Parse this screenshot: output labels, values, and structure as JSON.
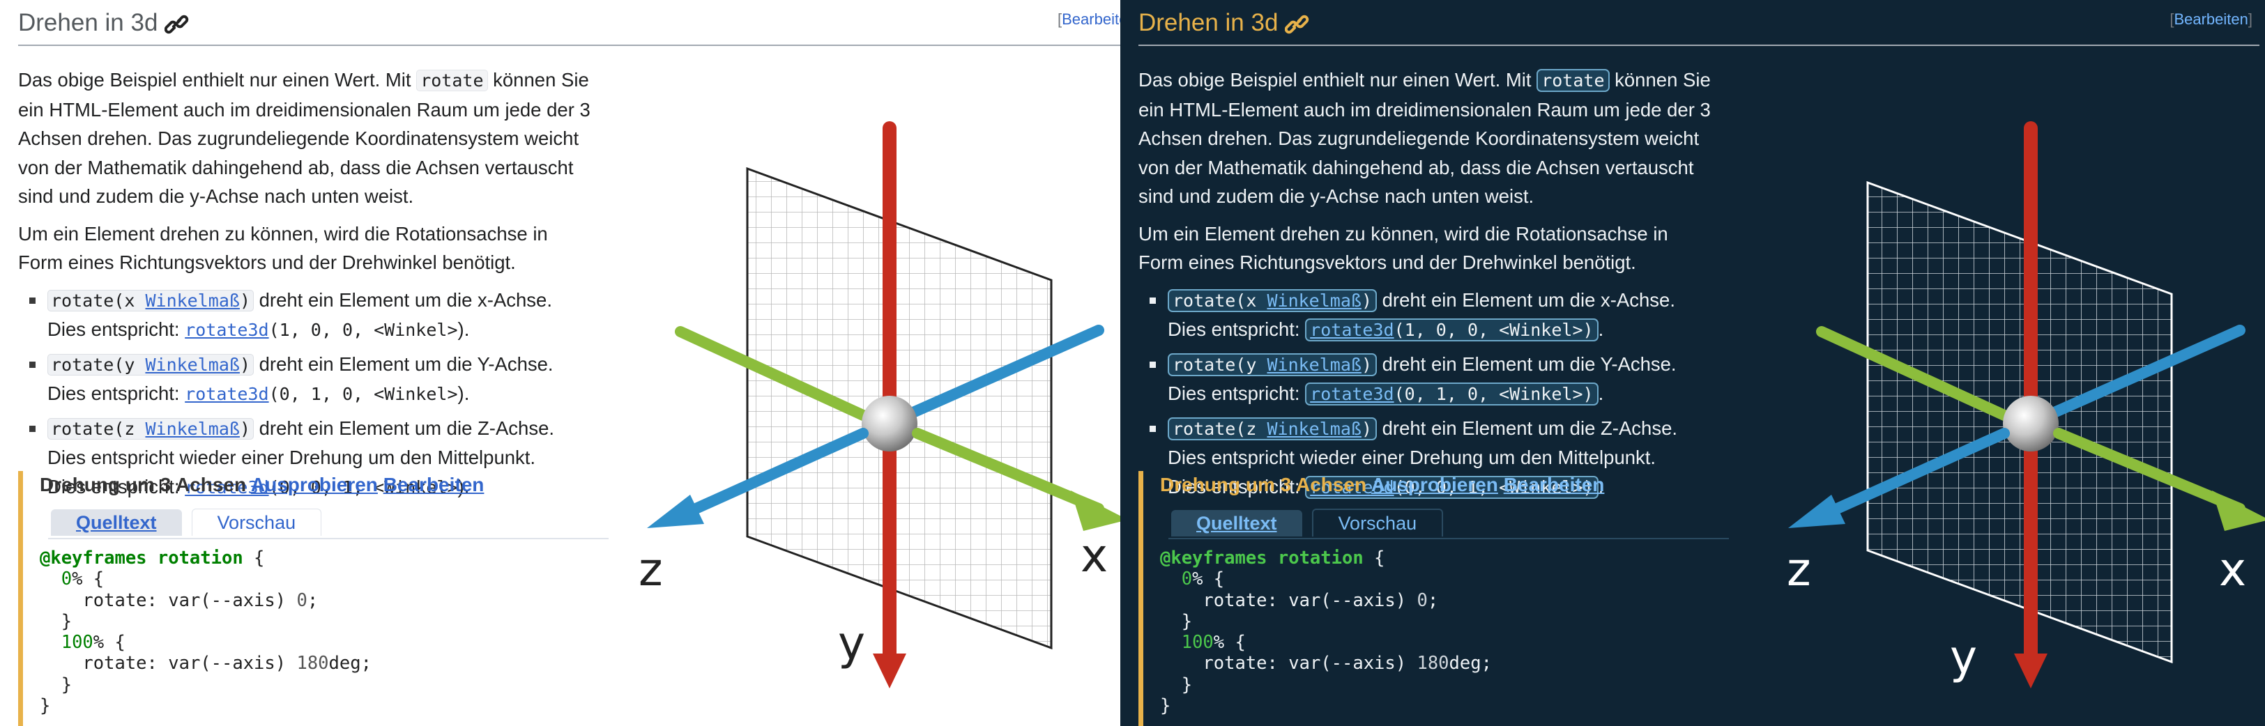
{
  "panels": [
    {
      "theme": "light",
      "heading": "Drehen in 3d",
      "edit_link": "Bearbeiten",
      "edit_visible": "Bearbeite",
      "paragraph1_a": "Das obige Beispiel enthielt nur einen Wert. Mit ",
      "paragraph1_code": "rotate",
      "paragraph1_b": " können Sie ein HTML-Element auch im dreidimensionalen Raum um jede der 3 Achsen drehen. Das zugrundeliegende Koordinatensystem weicht von der Mathematik dahingehend ab, dass die Achsen vertauscht sind und zudem die y-Achse nach unten weist.",
      "paragraph2": "Um ein Element drehen zu können, wird die Rotationsachse in Form eines Richtungsvektors und der Drehwinkel benötigt."
    },
    {
      "theme": "dark",
      "heading": "Drehen in 3d",
      "edit_link": "Bearbeiten",
      "edit_visible": "Bearbeiten",
      "paragraph1_a": "Das obige Beispiel enthielt nur einen Wert. Mit ",
      "paragraph1_code": "rotate",
      "paragraph1_b": " können Sie ein HTML-Element auch im dreidimensionalen Raum um jede der 3 Achsen drehen. Das zugrundeliegende Koordinatensystem weicht von der Mathematik dahingehend ab, dass die Achsen vertauscht sind und zudem die y-Achse nach unten weist.",
      "paragraph2": "Um ein Element drehen zu können, wird die Rotationsachse in Form eines Richtungsvektors und der Drehwinkel benötigt."
    }
  ],
  "list": [
    {
      "func_a": "rotate(x ",
      "func_link": "Winkelmaß",
      "func_b": ")",
      "desc": " dreht ein Element um die x-Achse.",
      "equiv_prefix": "Dies entspricht: ",
      "equiv_link": "rotate3d",
      "equiv_args": "(1, 0, 0, <Winkel>",
      "equiv_end": ").",
      "extra": ""
    },
    {
      "func_a": "rotate(y ",
      "func_link": "Winkelmaß",
      "func_b": ")",
      "desc": " dreht ein Element um die Y-Achse.",
      "equiv_prefix": "Dies entspricht: ",
      "equiv_link": "rotate3d",
      "equiv_args": "(0, 1, 0, <Winkel>",
      "equiv_end": ").",
      "extra": ""
    },
    {
      "func_a": "rotate(z ",
      "func_link": "Winkelmaß",
      "func_b": ")",
      "desc": " dreht ein Element um die Z-Achse.",
      "equiv_prefix": "Dies entspricht: ",
      "equiv_link": "rotate3d",
      "equiv_args": "(0, 0, 1, <Winkel>",
      "equiv_end": ").",
      "extra": "Dies entspricht wieder einer Drehung um den Mittelpunkt."
    }
  ],
  "demo": {
    "title": "Drehung um 3 Achsen",
    "try_link": "Ausprobieren",
    "edit_link": "Bearbeiten",
    "tab_source": "Quelltext",
    "tab_preview": "Vorschau",
    "code": {
      "l1_kw": "@keyframes rotation",
      "l1_rest": " {",
      "l2_pct": "0",
      "l2_rest": "% {",
      "l3_a": "rotate: var(--axis) ",
      "l3_num": "0",
      "l3_b": ";",
      "l4": "}",
      "l5_pct": "100",
      "l5_rest": "% {",
      "l6_a": "rotate: var(--axis) ",
      "l6_num": "180",
      "l6_b": "deg;",
      "l7": "}",
      "l8": "}"
    }
  },
  "figure": {
    "label_x": "x",
    "label_y": "y",
    "label_z": "z",
    "colors": {
      "x_axis": "#8cbd3c",
      "y_axis": "#c62d1f",
      "z_axis": "#2f8fc9"
    }
  }
}
